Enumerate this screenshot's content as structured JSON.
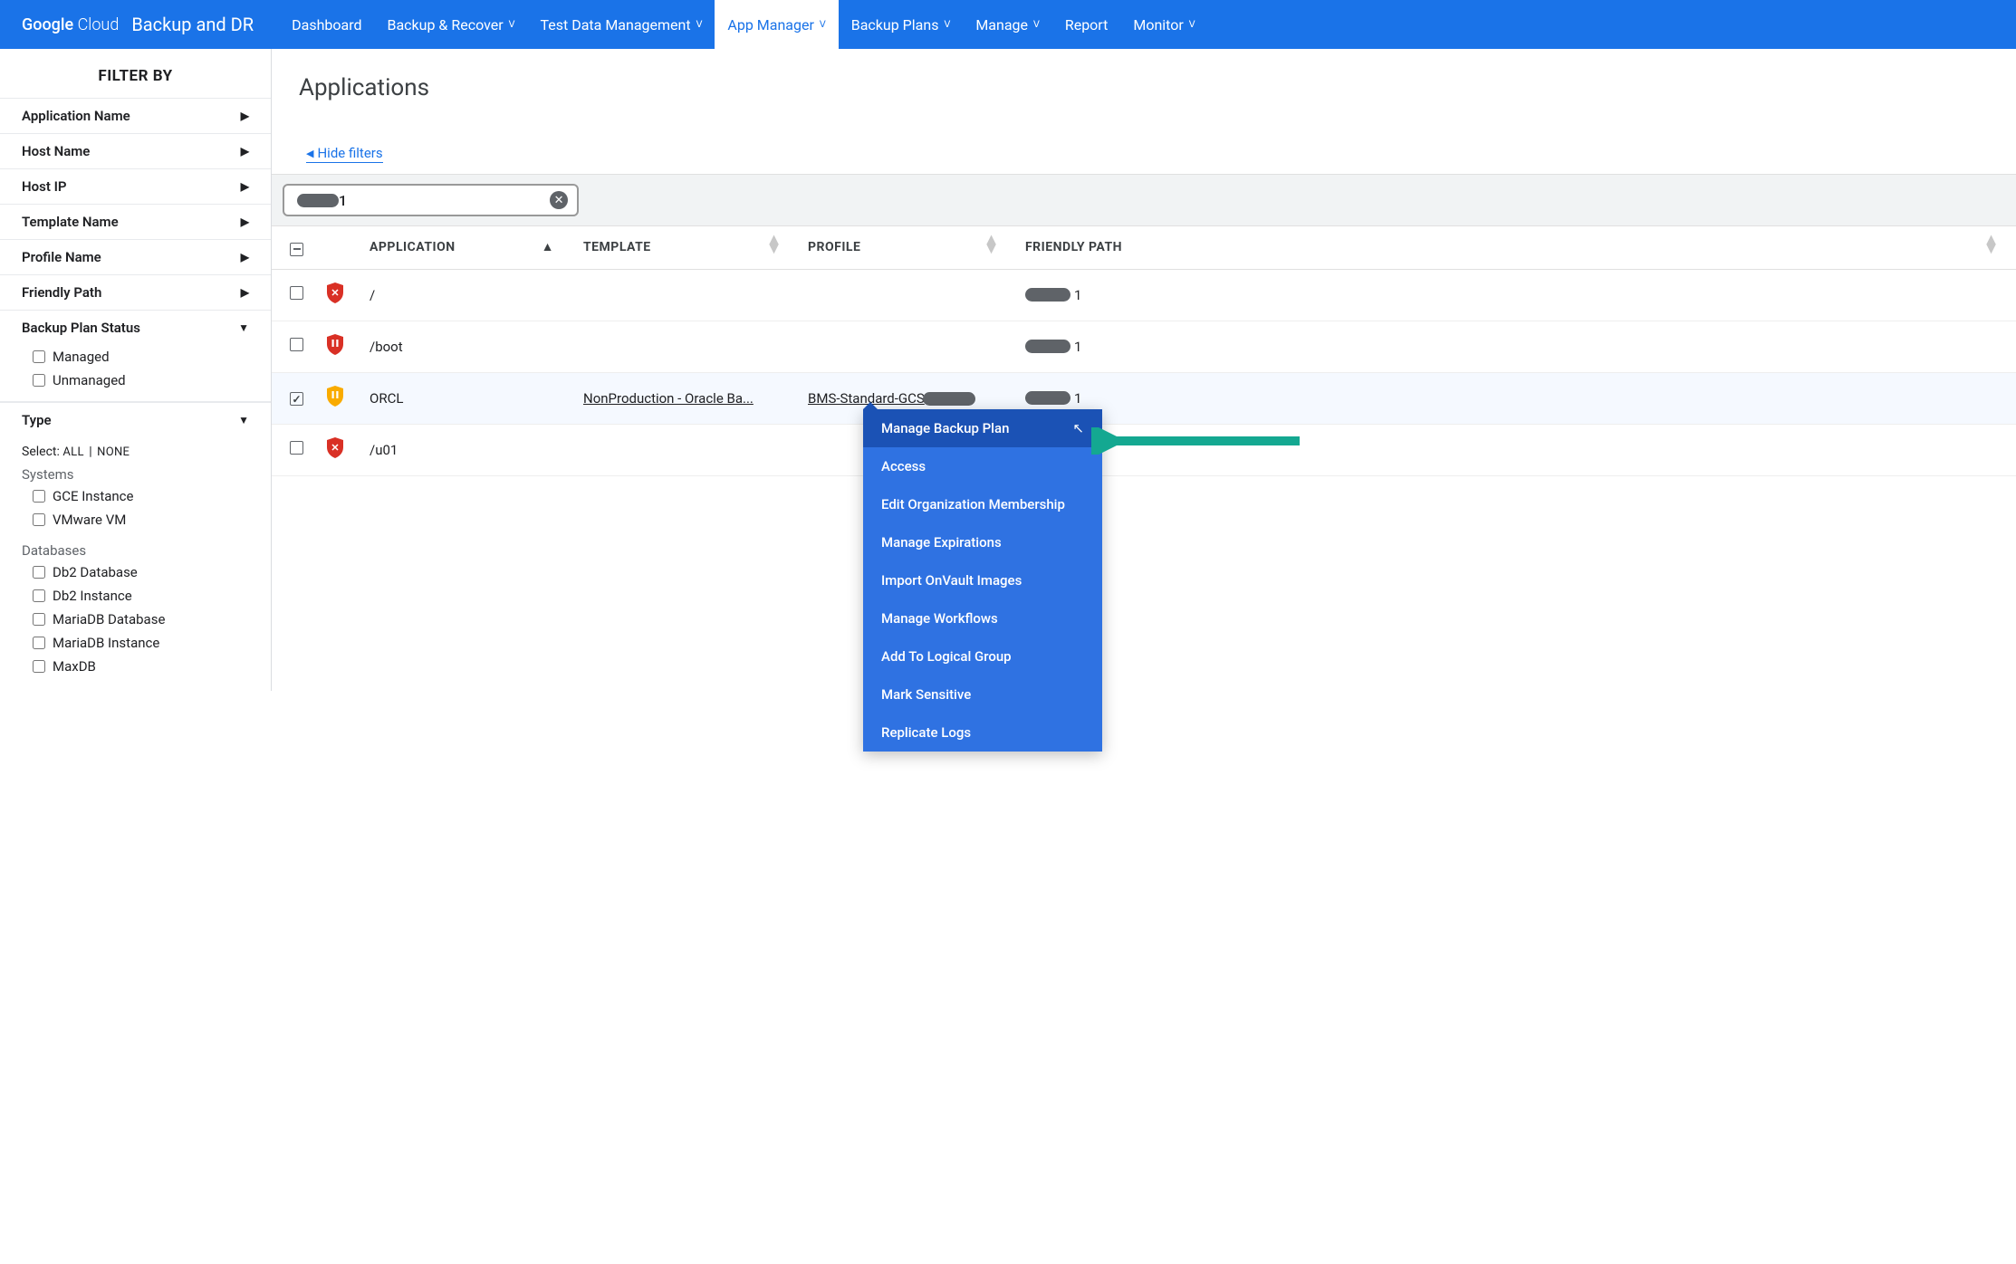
{
  "header": {
    "logo_brand": "Google",
    "logo_suffix": "Cloud",
    "product": "Backup and DR",
    "nav": [
      {
        "label": "Dashboard",
        "dropdown": false
      },
      {
        "label": "Backup & Recover",
        "dropdown": true
      },
      {
        "label": "Test Data Management",
        "dropdown": true
      },
      {
        "label": "App Manager",
        "dropdown": true,
        "active": true
      },
      {
        "label": "Backup Plans",
        "dropdown": true
      },
      {
        "label": "Manage",
        "dropdown": true
      },
      {
        "label": "Report",
        "dropdown": false
      },
      {
        "label": "Monitor",
        "dropdown": true
      }
    ]
  },
  "sidebar": {
    "title": "FILTER BY",
    "filters": [
      {
        "label": "Application Name",
        "expanded": false
      },
      {
        "label": "Host Name",
        "expanded": false
      },
      {
        "label": "Host IP",
        "expanded": false
      },
      {
        "label": "Template Name",
        "expanded": false
      },
      {
        "label": "Profile Name",
        "expanded": false
      },
      {
        "label": "Friendly Path",
        "expanded": false
      },
      {
        "label": "Backup Plan Status",
        "expanded": true
      }
    ],
    "backup_plan_opts": [
      "Managed",
      "Unmanaged"
    ],
    "type_label": "Type",
    "select_prefix": "Select:",
    "select_all": "ALL",
    "select_none": "NONE",
    "systems_label": "Systems",
    "systems_opts": [
      "GCE Instance",
      "VMware VM"
    ],
    "databases_label": "Databases",
    "databases_opts": [
      "Db2 Database",
      "Db2 Instance",
      "MariaDB Database",
      "MariaDB Instance",
      "MaxDB"
    ]
  },
  "content": {
    "title": "Applications",
    "hide_filters": "Hide filters",
    "search_suffix": "1",
    "columns": {
      "application": "APPLICATION",
      "template": "TEMPLATE",
      "profile": "PROFILE",
      "friendly_path": "FRIENDLY PATH"
    },
    "rows": [
      {
        "status": "red-x",
        "app": "/",
        "template": "",
        "profile": "",
        "fp_suffix": "1",
        "checked": false
      },
      {
        "status": "red-pause",
        "app": "/boot",
        "template": "",
        "profile": "",
        "fp_suffix": "1",
        "checked": false
      },
      {
        "status": "orange-pause",
        "app": "ORCL",
        "template": "NonProduction - Oracle Ba...",
        "profile": "BMS-Standard-GCS",
        "fp_suffix": "1",
        "checked": true
      },
      {
        "status": "red-x",
        "app": "/u01",
        "template": "",
        "profile": "",
        "fp_suffix": "1",
        "checked": false
      }
    ]
  },
  "context_menu": {
    "items": [
      "Manage Backup Plan",
      "Access",
      "Edit Organization Membership",
      "Manage Expirations",
      "Import OnVault Images",
      "Manage Workflows",
      "Add To Logical Group",
      "Mark Sensitive",
      "Replicate Logs"
    ],
    "hovered": 0
  }
}
